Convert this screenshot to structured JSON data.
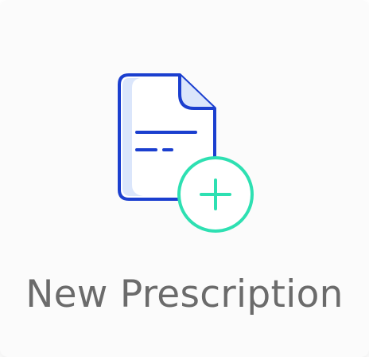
{
  "tile": {
    "label": "New Prescription",
    "icon": "document-add-icon"
  },
  "colors": {
    "document_stroke": "#1b3fcf",
    "document_fill": "#dbe6fb",
    "plus_stroke": "#2ee0b2",
    "label_text": "#6b6b6b",
    "tile_background": "#fbfbfb"
  }
}
